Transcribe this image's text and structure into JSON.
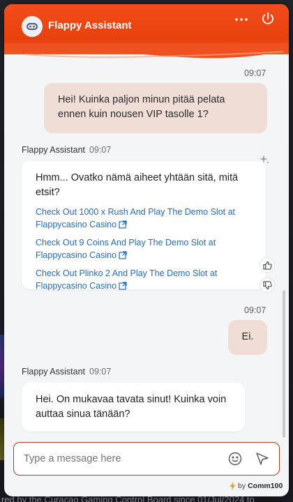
{
  "header": {
    "title": "Flappy Assistant",
    "menu_icon": "more-horizontal-icon",
    "power_icon": "power-icon",
    "accent_color": "#ee4a15"
  },
  "messages": [
    {
      "type": "user",
      "time": "09:07",
      "text": "Hei! Kuinka paljon minun pitää pelata ennen kuin nousen VIP tasolle 1?"
    },
    {
      "type": "bot",
      "sender": "Flappy Assistant",
      "time": "09:07",
      "text": "Hmm... Ovatko nämä aiheet yhtään sitä, mitä etsit?",
      "links": [
        "Check Out 1000 x Rush And Play The Demo Slot at Flappycasino Casino",
        "Check Out 9 Coins And Play The Demo Slot at Flappycasino Casino",
        "Check Out Plinko 2 And Play The Demo Slot at Flappycasino Casino"
      ]
    },
    {
      "type": "user",
      "time": "09:07",
      "text": "Ei."
    },
    {
      "type": "bot",
      "sender": "Flappy Assistant",
      "time": "09:07",
      "text": "Hei. On mukavaa tavata sinut! Kuinka voin auttaa sinua tänään?"
    }
  ],
  "composer": {
    "placeholder": "Type a message here",
    "value": ""
  },
  "footer": {
    "by": "by",
    "brand": "Comm100"
  },
  "background_page": {
    "footer_text": "red by the Curacao Gaming Control Board since 01/Jul/2024 to"
  }
}
